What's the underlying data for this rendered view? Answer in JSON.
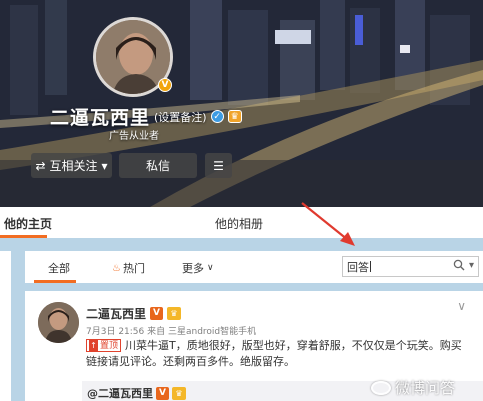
{
  "profile": {
    "nickname": "二逼瓦西里",
    "remark_link": "(设置备注)",
    "bio": "广告从业者",
    "follow_status": "互相关注",
    "message_button": "私信"
  },
  "tabs": {
    "home": "他的主页",
    "album": "他的相册"
  },
  "filter": {
    "all": "全部",
    "hot": "热门",
    "more": "更多"
  },
  "search": {
    "value": "回答"
  },
  "post": {
    "author": "二逼瓦西里",
    "meta": "7月3日 21:56 来自 三星android智能手机",
    "pinned_label": "置顶",
    "text": "川菜牛逼T，质地很好，版型也好，穿着舒服，不仅仅是个玩笑。购买链接请见评论。还剩两百多件。绝版留存。",
    "forward_author": "@二逼瓦西里"
  },
  "watermark": "微博问答",
  "colors": {
    "accent_orange": "#f26d22",
    "page_bg": "#b9d4e6",
    "annotation_arrow": "#e03a2f"
  }
}
